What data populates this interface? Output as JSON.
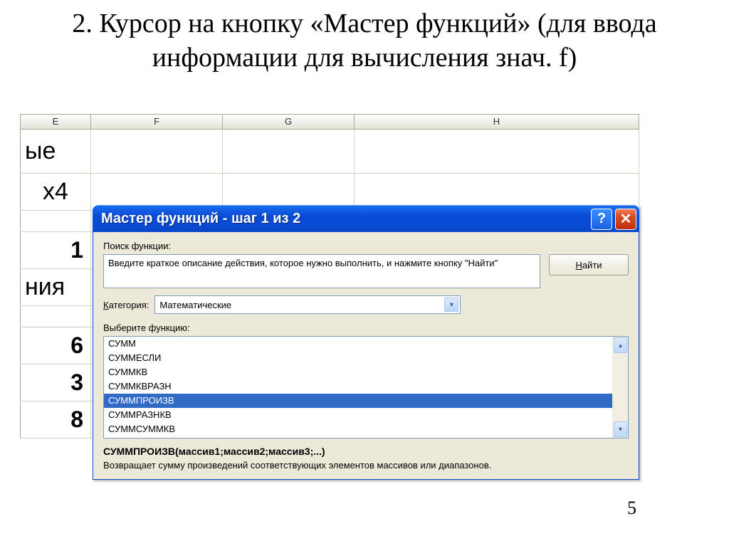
{
  "slide": {
    "title": "2. Курсор на кнопку «Мастер функций» (для ввода информации для вычисления знач. f)",
    "page_number": "5"
  },
  "sheet": {
    "columns": {
      "E": "E",
      "F": "F",
      "G": "G",
      "H": "H"
    },
    "rows": {
      "r1_partial": "ые",
      "r2_x4": "x4",
      "r3_num": "1",
      "r4_partial": "ния",
      "r5_num": "6",
      "r6_num": "3",
      "r7_num": "8"
    }
  },
  "dialog": {
    "title": "Мастер функций - шаг 1 из 2",
    "help_glyph": "?",
    "close_glyph": "✕",
    "search_label": "Поиск функции:",
    "search_text": "Введите краткое описание действия, которое нужно выполнить, и нажмите кнопку \"Найти\"",
    "find_prefix": "Н",
    "find_rest": "айти",
    "category_prefix": "К",
    "category_rest": "атегория:",
    "category_value": "Математические",
    "select_label": "Выберите функцию:",
    "functions": [
      "СУММ",
      "СУММЕСЛИ",
      "СУММКВ",
      "СУММКВРАЗН",
      "СУММПРОИЗВ",
      "СУММРАЗНКВ",
      "СУММСУММКВ"
    ],
    "selected_index": 4,
    "syntax": "СУММПРОИЗВ(массив1;массив2;массив3;...)",
    "description": "Возвращает сумму произведений соответствующих элементов массивов или диапазонов."
  }
}
